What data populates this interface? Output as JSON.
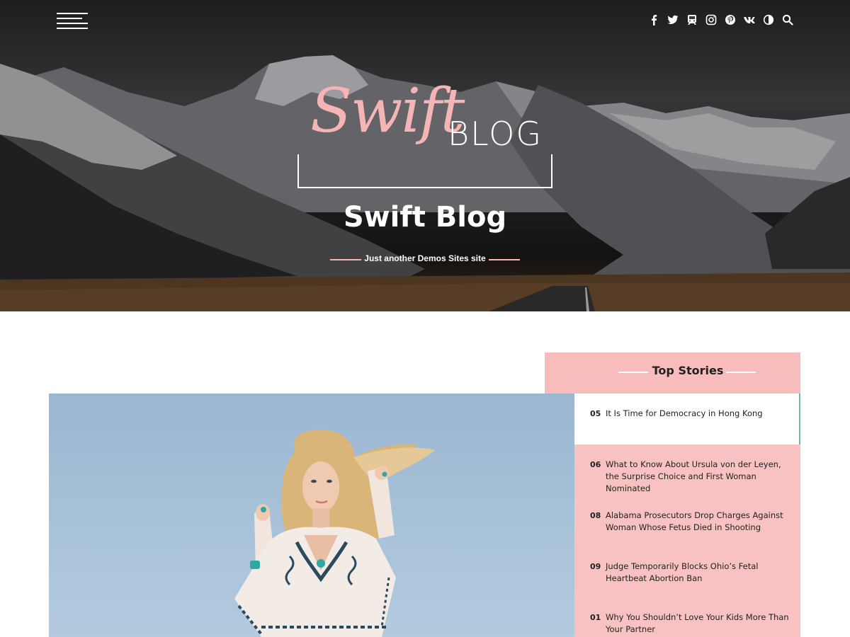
{
  "header": {
    "logo": {
      "script": "Swift",
      "word": "BLOG"
    },
    "site_title": "Swift Blog",
    "tagline": "Just another Demos Sites site",
    "social_icons": [
      "facebook-icon",
      "twitter-icon",
      "tripadvisor-icon",
      "instagram-icon",
      "pinterest-icon",
      "vk-icon",
      "dark-mode-toggle-icon",
      "search-icon"
    ]
  },
  "top_stories": {
    "title": "Top Stories",
    "items": [
      {
        "num": "05",
        "title": "It Is Time for Democracy in Hong Kong"
      },
      {
        "num": "06",
        "title": "What to Know About Ursula von der Leyen, the Surprise Choice and First Woman Nominated"
      },
      {
        "num": "08",
        "title": "Alabama Prosecutors Drop Charges Against Woman Whose Fetus Died in Shooting"
      },
      {
        "num": "09",
        "title": "Judge Temporarily Blocks Ohio’s Fetal Heartbeat Abortion Ban"
      },
      {
        "num": "01",
        "title": "Why You Shouldn’t Love Your Kids More Than Your Partner"
      }
    ]
  },
  "colors": {
    "accent_pink": "#f9bcbc",
    "active_border": "#6fb5a8",
    "text_dark": "#222222"
  }
}
